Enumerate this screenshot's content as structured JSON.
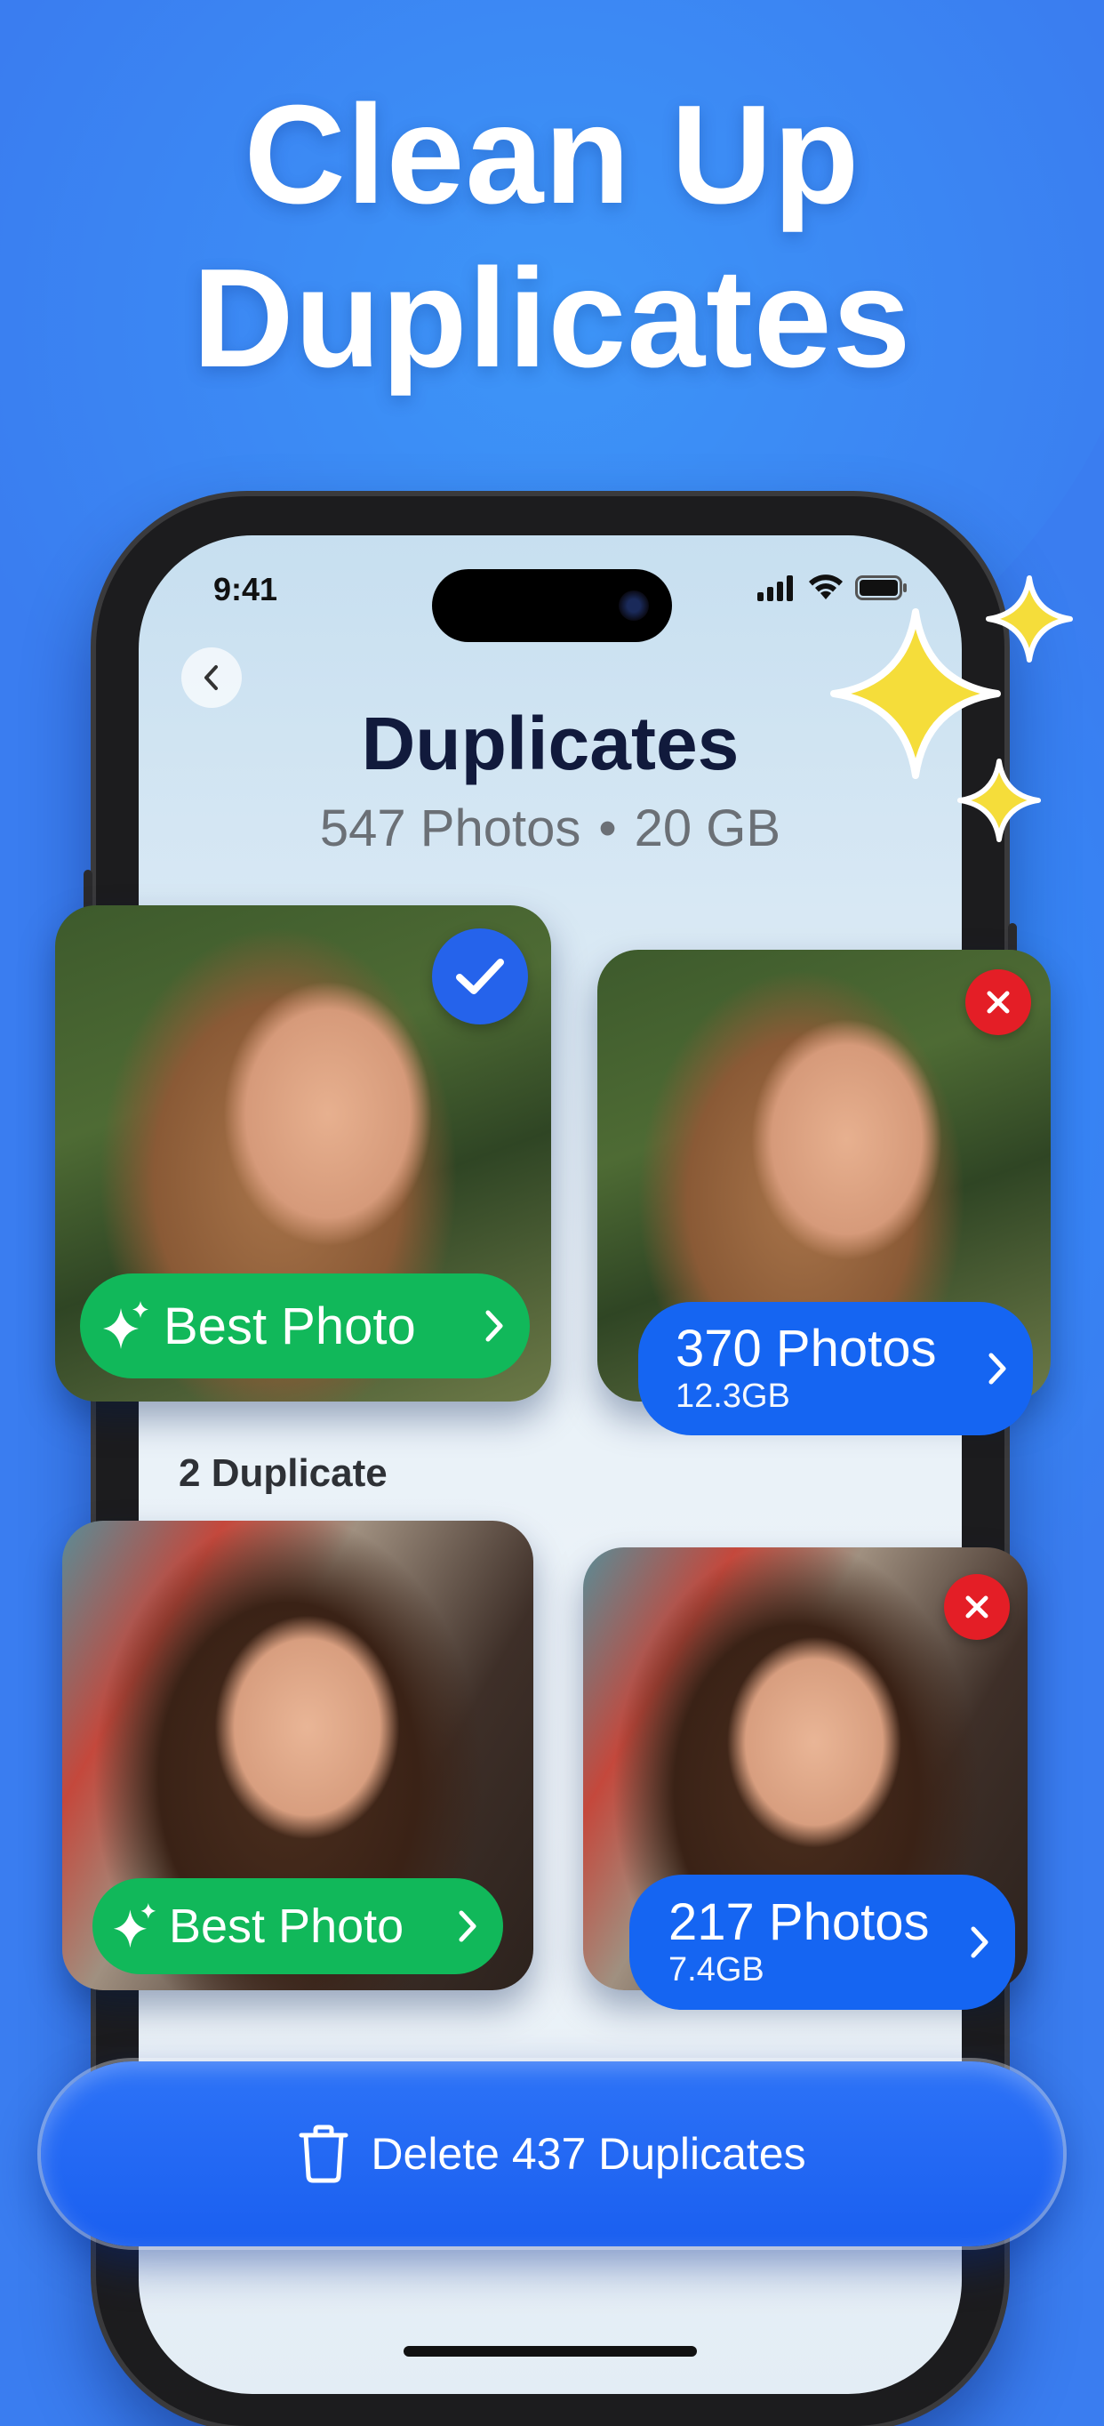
{
  "headline": {
    "line1": "Clean Up",
    "line2": "Duplicates"
  },
  "status_bar": {
    "time": "9:41"
  },
  "screen": {
    "title": "Duplicates",
    "photos_count": "547 Photos",
    "separator": "•",
    "storage": "20 GB",
    "section_label": "2 Duplicate"
  },
  "groups": [
    {
      "best_label": "Best Photo",
      "count_label": "370 Photos",
      "size_label": "12.3GB"
    },
    {
      "best_label": "Best Photo",
      "count_label": "217 Photos",
      "size_label": "7.4GB"
    }
  ],
  "delete_button": {
    "label": "Delete 437 Duplicates"
  },
  "colors": {
    "background": "#3a7df0",
    "best_green": "#11b85a",
    "count_blue": "#1565f2",
    "remove_red": "#e41e26",
    "check_blue": "#2563eb",
    "sparkle_yellow": "#f5dd3a"
  },
  "icons": [
    "back-chevron-icon",
    "signal-icon",
    "wifi-icon",
    "battery-icon",
    "sparkles-icon",
    "chevron-right-icon",
    "checkmark-icon",
    "close-icon",
    "trash-icon",
    "star-sparkle-icon"
  ]
}
